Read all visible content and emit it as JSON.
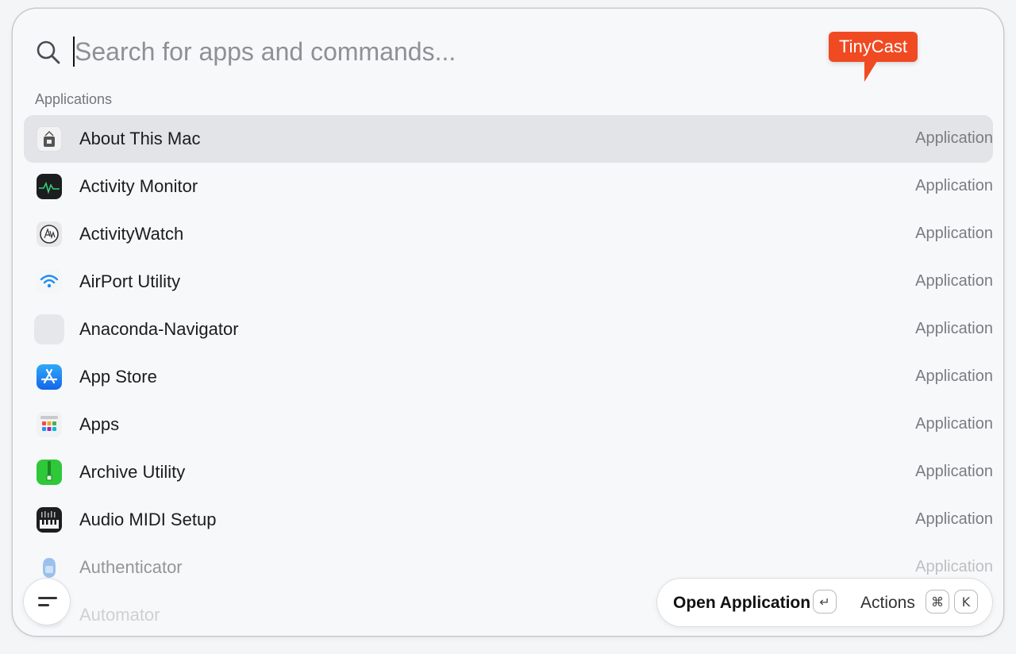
{
  "search": {
    "placeholder": "Search for apps and commands...",
    "value": ""
  },
  "brand": {
    "label": "TinyCast",
    "color": "#f04a22"
  },
  "section": {
    "header": "Applications"
  },
  "items": [
    {
      "name": "About This Mac",
      "kind": "Application",
      "icon": "about-this-mac-icon"
    },
    {
      "name": "Activity Monitor",
      "kind": "Application",
      "icon": "activity-monitor-icon"
    },
    {
      "name": "ActivityWatch",
      "kind": "Application",
      "icon": "activitywatch-icon"
    },
    {
      "name": "AirPort Utility",
      "kind": "Application",
      "icon": "airport-utility-icon"
    },
    {
      "name": "Anaconda-Navigator",
      "kind": "Application",
      "icon": "anaconda-navigator-icon"
    },
    {
      "name": "App Store",
      "kind": "Application",
      "icon": "app-store-icon"
    },
    {
      "name": "Apps",
      "kind": "Application",
      "icon": "apps-icon"
    },
    {
      "name": "Archive Utility",
      "kind": "Application",
      "icon": "archive-utility-icon"
    },
    {
      "name": "Audio MIDI Setup",
      "kind": "Application",
      "icon": "audio-midi-setup-icon"
    },
    {
      "name": "Authenticator",
      "kind": "Application",
      "icon": "authenticator-icon"
    },
    {
      "name": "Automator",
      "kind": "",
      "icon": "automator-icon"
    }
  ],
  "selected_index": 0,
  "footer": {
    "primary_action": "Open Application",
    "primary_key": "↵",
    "secondary_action": "Actions",
    "secondary_keys": [
      "⌘",
      "K"
    ]
  }
}
